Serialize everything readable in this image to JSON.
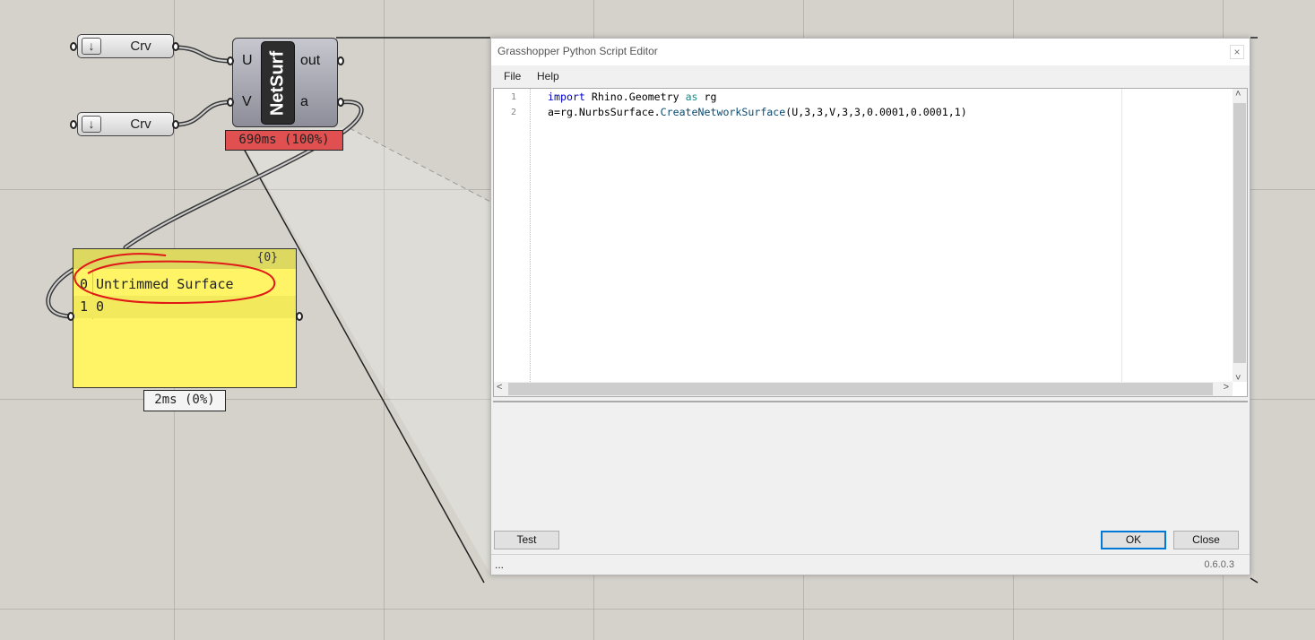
{
  "canvas": {
    "params": [
      {
        "label": "Crv"
      },
      {
        "label": "Crv"
      }
    ],
    "netsurf": {
      "nickname": "NetSurf",
      "inputs": [
        "U",
        "V"
      ],
      "outputs": [
        "out",
        "a"
      ],
      "timer": "690ms (100%)"
    },
    "panel": {
      "path": "{0}",
      "rows": [
        {
          "index": "0",
          "value": "Untrimmed Surface"
        },
        {
          "index": "1",
          "value": "0"
        }
      ],
      "timer": "2ms (0%)"
    }
  },
  "editor": {
    "title": "Grasshopper Python Script Editor",
    "close_glyph": "×",
    "menu": [
      "File",
      "Help"
    ],
    "line_numbers": [
      "1",
      "2"
    ],
    "code": {
      "line1": {
        "kw_import": "import",
        "module": " Rhino.Geometry ",
        "kw_as": "as",
        "alias": " rg"
      },
      "line2": {
        "prefix": "a=rg.NurbsSurface.",
        "fn": "CreateNetworkSurface",
        "args": "(U,3,3,V,3,3,0.0001,0.0001,1)"
      }
    },
    "buttons": {
      "test": "Test",
      "ok": "OK",
      "close": "Close"
    },
    "status": {
      "dots": "...",
      "version": "0.6.0.3"
    }
  }
}
